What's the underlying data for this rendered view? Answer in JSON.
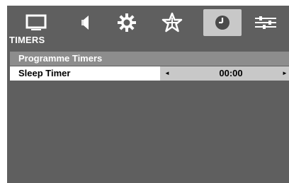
{
  "menu": {
    "section_title": "TIMERS",
    "icons": [
      {
        "name": "picture-icon",
        "active": false
      },
      {
        "name": "sound-icon",
        "active": false
      },
      {
        "name": "settings-gear-icon",
        "active": false
      },
      {
        "name": "channels-star-icon",
        "active": false
      },
      {
        "name": "clock-icon",
        "active": true
      },
      {
        "name": "setup-sliders-icon",
        "active": false
      }
    ]
  },
  "group": {
    "header": "Programme Timers"
  },
  "sleep_timer": {
    "label": "Sleep Timer",
    "value": "00:00",
    "left_arrow": "◄",
    "right_arrow": "►"
  },
  "colors": {
    "background": "#5f5f5f",
    "header": "#8d8d8d",
    "active_tab": "#c8c8c8",
    "selected_row": "#ffffff"
  }
}
